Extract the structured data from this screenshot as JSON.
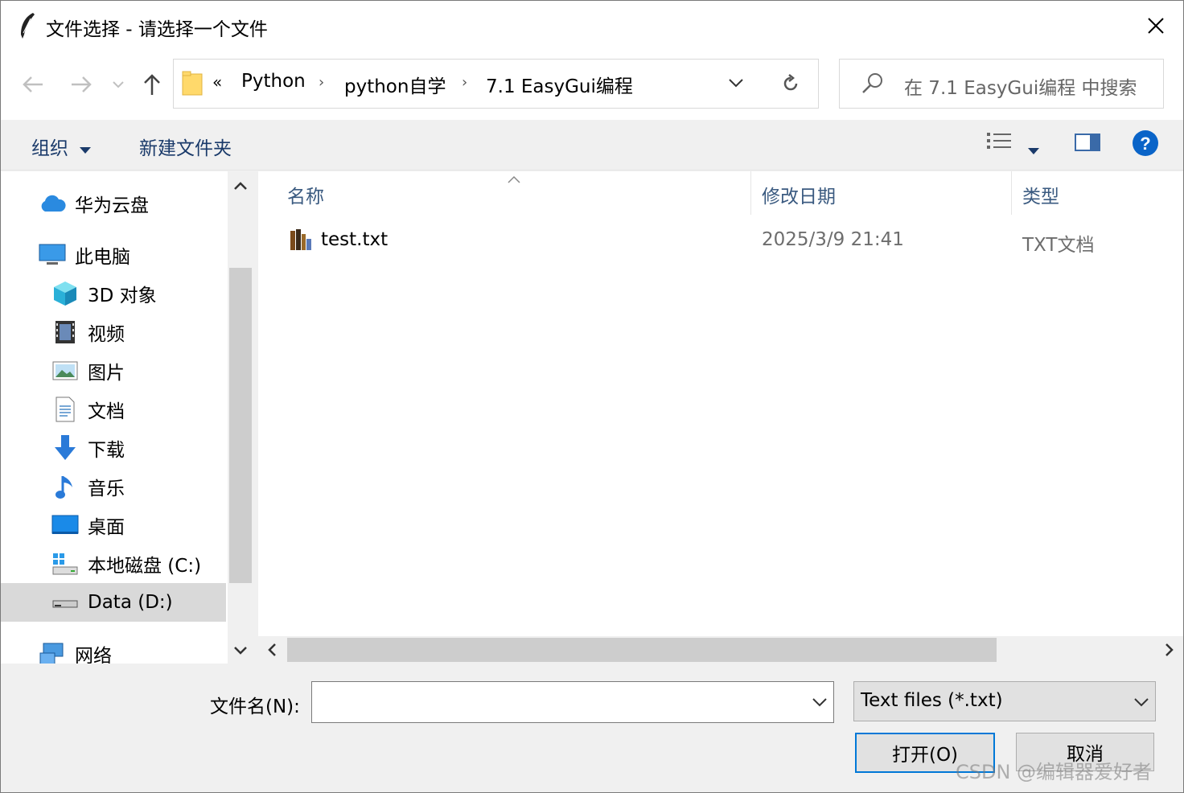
{
  "window": {
    "title": "文件选择 - 请选择一个文件"
  },
  "address": {
    "overflow": "«",
    "segments": [
      "Python",
      "python自学",
      "7.1 EasyGui编程"
    ]
  },
  "search": {
    "placeholder": "在 7.1 EasyGui编程 中搜索"
  },
  "toolbar": {
    "organize": "组织",
    "new_folder": "新建文件夹"
  },
  "sidebar": {
    "items": [
      {
        "label": "华为云盘",
        "icon": "cloud-icon"
      },
      {
        "label": "此电脑",
        "icon": "computer-icon"
      },
      {
        "label": "3D 对象",
        "icon": "cube-3d-icon"
      },
      {
        "label": "视频",
        "icon": "video-icon"
      },
      {
        "label": "图片",
        "icon": "picture-icon"
      },
      {
        "label": "文档",
        "icon": "document-icon"
      },
      {
        "label": "下载",
        "icon": "download-icon"
      },
      {
        "label": "音乐",
        "icon": "music-icon"
      },
      {
        "label": "桌面",
        "icon": "desktop-icon"
      },
      {
        "label": "本地磁盘 (C:)",
        "icon": "local-disk-icon"
      },
      {
        "label": "Data (D:)",
        "icon": "drive-icon"
      },
      {
        "label": "网络",
        "icon": "network-icon"
      }
    ],
    "selected": "Data (D:)"
  },
  "file_list": {
    "columns": [
      "名称",
      "修改日期",
      "类型"
    ],
    "rows": [
      {
        "name": "test.txt",
        "modified": "2025/3/9 21:41",
        "type": "TXT文档"
      }
    ]
  },
  "bottom": {
    "filename_label": "文件名(N):",
    "filename_value": "",
    "filetype_selected": "Text files (*.txt)",
    "open_label": "打开(O)",
    "cancel_label": "取消"
  },
  "watermark": "CSDN @编辑器爱好者",
  "colors": {
    "accent": "#0078d7",
    "help": "#0a64c8",
    "selection": "#d9d9d9"
  }
}
